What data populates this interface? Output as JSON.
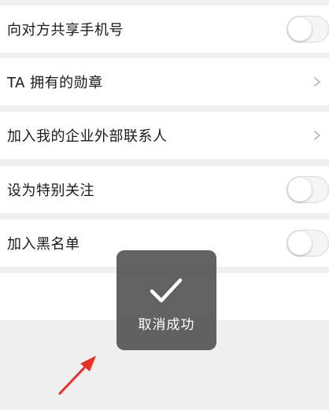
{
  "settings": {
    "rows": [
      {
        "label": "向对方共享手机号",
        "control": "toggle",
        "on": false
      },
      {
        "label": "TA 拥有的勋章",
        "control": "chevron"
      },
      {
        "label": "加入我的企业外部联系人",
        "control": "chevron"
      },
      {
        "label": "设为特别关注",
        "control": "toggle",
        "on": false
      },
      {
        "label": "加入黑名单",
        "control": "toggle",
        "on": false
      }
    ]
  },
  "toast": {
    "icon": "checkmark-icon",
    "message": "取消成功"
  },
  "annotation": {
    "icon": "red-arrow-icon",
    "color": "#e8302a"
  },
  "colors": {
    "background": "#efefef",
    "row_background": "#ffffff",
    "toast_background": "#555555"
  }
}
